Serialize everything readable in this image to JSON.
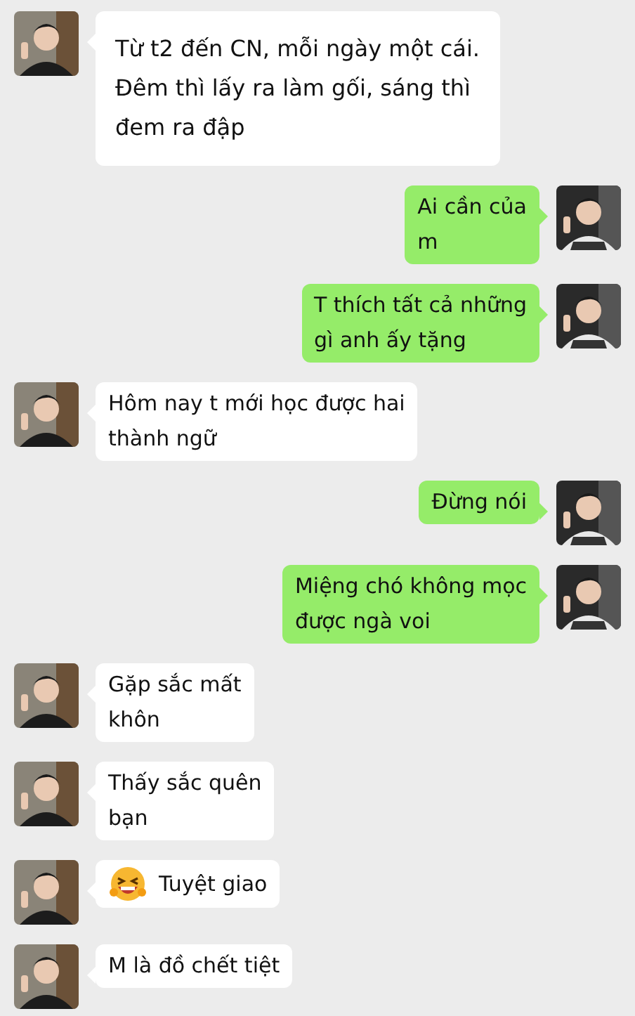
{
  "messages": [
    {
      "outgoing": false,
      "kind": "text",
      "text": "Từ t2 đến CN, mỗi ngày một cái.\nĐêm thì lấy ra làm gối, sáng thì\nđem ra đập"
    },
    {
      "outgoing": true,
      "kind": "text",
      "text": "Ai cần của\nm"
    },
    {
      "outgoing": true,
      "kind": "text",
      "text": "T thích tất cả những\ngì anh ấy tặng"
    },
    {
      "outgoing": false,
      "kind": "text",
      "text": "Hôm nay t mới học được hai\nthành ngữ"
    },
    {
      "outgoing": true,
      "kind": "text",
      "text": "Đừng nói"
    },
    {
      "outgoing": true,
      "kind": "text",
      "text": "Miệng chó không mọc\nđược ngà voi"
    },
    {
      "outgoing": false,
      "kind": "text",
      "text": "Gặp sắc mất\nkhôn"
    },
    {
      "outgoing": false,
      "kind": "text",
      "text": "Thấy sắc quên\nbạn"
    },
    {
      "outgoing": false,
      "kind": "emoji",
      "text": "Tuyệt giao"
    },
    {
      "outgoing": false,
      "kind": "text",
      "text": "M là đồ chết tiệt"
    }
  ]
}
